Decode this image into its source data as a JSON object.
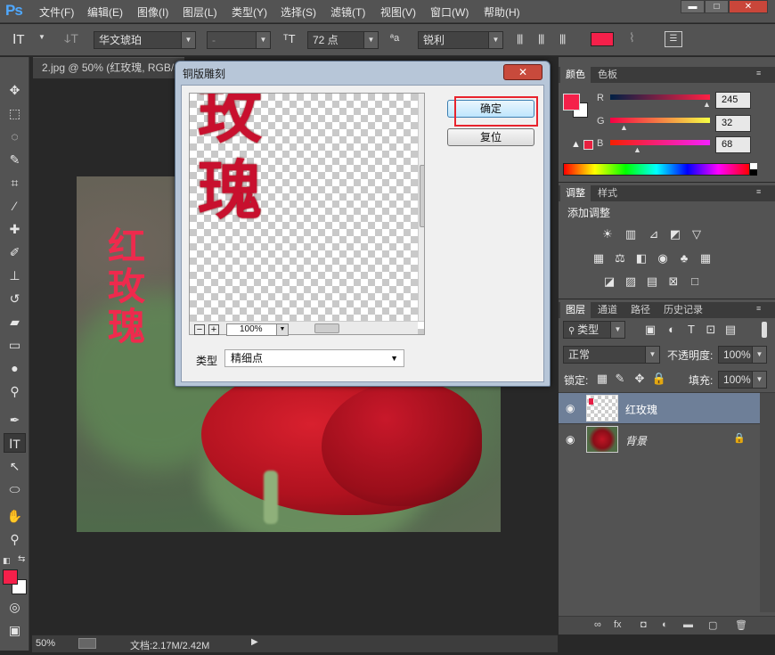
{
  "app": {
    "logo": "Ps"
  },
  "menu": [
    "文件(F)",
    "编辑(E)",
    "图像(I)",
    "图层(L)",
    "类型(Y)",
    "选择(S)",
    "滤镜(T)",
    "视图(V)",
    "窗口(W)",
    "帮助(H)"
  ],
  "window_controls": {
    "minimize": "▬",
    "restore": "□",
    "close": "✕"
  },
  "options": {
    "font_family": "华文琥珀",
    "font_style": "-",
    "font_size": "72 点",
    "aa_label": "ªa",
    "antialias": "锐利",
    "color": "#f5204a"
  },
  "document_tab": {
    "title": "2.jpg @ 50% (红玫瑰, RGB/8)"
  },
  "canvas_text": {
    "line1": "红",
    "line2": "玫",
    "line3": "瑰"
  },
  "status": {
    "zoom": "50%",
    "doc": "文档:2.17M/2.42M"
  },
  "color_panel": {
    "tabs": [
      "颜色",
      "色板"
    ],
    "channels": [
      {
        "label": "R",
        "value": "245"
      },
      {
        "label": "G",
        "value": "32"
      },
      {
        "label": "B",
        "value": "68"
      }
    ],
    "foreground": "#f5204a"
  },
  "adjust_panel": {
    "tabs": [
      "调整",
      "样式"
    ],
    "heading": "添加调整"
  },
  "layers_panel": {
    "tabs": [
      "图层",
      "通道",
      "路径",
      "历史记录"
    ],
    "filter": "类型",
    "blend_mode": "正常",
    "opacity_label": "不透明度:",
    "opacity": "100%",
    "lock_label": "锁定:",
    "fill_label": "填充:",
    "fill": "100%",
    "layers": [
      {
        "name": "红玫瑰",
        "selected": true
      },
      {
        "name": "背景",
        "selected": false
      }
    ]
  },
  "dialog": {
    "title": "铜版雕刻",
    "close": "✕",
    "ok": "确定",
    "reset": "复位",
    "zoom": "100%",
    "minus": "−",
    "plus": "+",
    "type_label": "类型",
    "type_value": "精细点",
    "preview_text1": "玫",
    "preview_text2": "瑰"
  }
}
